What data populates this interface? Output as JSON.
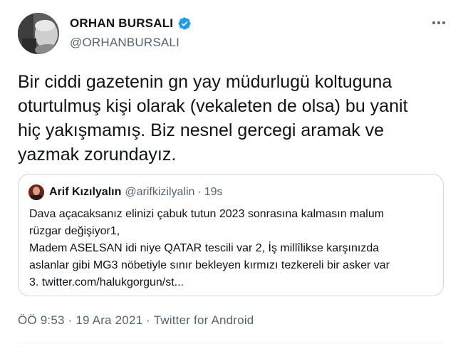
{
  "author": {
    "name": "ORHAN BURSALI",
    "handle": "@ORHANBURSALI",
    "verified": true,
    "verified_color": "#1d9bf0"
  },
  "tweet_text_lines": [
    "Bir ciddi gazetenin gn yay müdurlugü koltuguna",
    "oturtulmuş kişi olarak (vekaleten de olsa) bu yanit",
    "hiç yakışmamış. Biz nesnel gercegi aramak ve",
    "yazmak zorundayız."
  ],
  "quoted_tweet": {
    "name": "Arif Kızılyalın",
    "handle": "@arifkizilyalin",
    "separator": "·",
    "time": "19s",
    "text_lines": [
      "Dava açacaksanız elinizi çabuk tutun 2023 sonrasına kalmasın malum",
      "rüzgar değişiyor1,",
      "Madem ASELSAN idi niye QATAR tescili var 2, İş millîlikse karşınızda",
      "aslanlar gibi MG3 nöbetiyle sınır bekleyen kırmızı tezkereli bir asker var",
      "3. twitter.com/halukgorgun/st..."
    ]
  },
  "meta": "ÖÖ 9:53 · 19 Ara 2021 · Twitter for Android",
  "icons": {
    "more": "more-options-icon",
    "verified": "verified-badge-icon"
  }
}
